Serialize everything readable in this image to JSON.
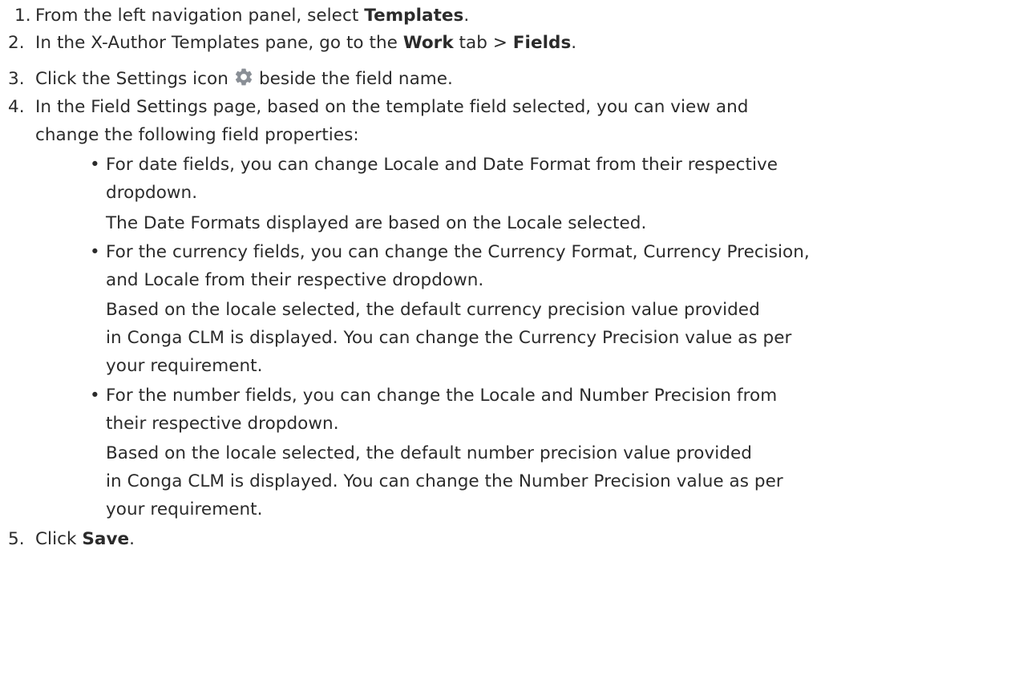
{
  "steps": [
    {
      "number": "1.",
      "pre": "From the left navigation panel, select ",
      "bold": "Templates",
      "post": "."
    },
    {
      "number": "2.",
      "pre": "In the X-Author Templates pane, go to the ",
      "bold1": "Work",
      "mid": " tab > ",
      "bold2": "Fields",
      "post": "."
    },
    {
      "number": "3.",
      "pre": "Click the Settings icon",
      "icon": "gear-icon",
      "post": "beside the field name."
    },
    {
      "number": "4.",
      "line1": "In the Field Settings page, based on the template field selected, you can view and",
      "line2": "change the following field properties:",
      "bullets": [
        {
          "lines": [
            "For date fields, you can change Locale and Date Format from their respective",
            "dropdown.",
            "The Date Formats displayed are based on the Locale selected."
          ]
        },
        {
          "lines": [
            "For the currency fields, you can change the Currency Format, Currency Precision,",
            "and Locale from their respective dropdown.",
            "Based on the locale selected, the default currency precision value provided",
            "in Conga CLM is displayed. You can change the Currency Precision value as per",
            "your requirement."
          ]
        },
        {
          "lines": [
            "For the number fields, you can change the Locale and Number Precision from",
            "their respective dropdown.",
            "Based on the locale selected, the default number precision value provided",
            "in Conga CLM is displayed. You can change the Number Precision value as per",
            "your requirement."
          ]
        }
      ],
      "bullet_symbol": "•"
    },
    {
      "number": "5.",
      "pre": "Click ",
      "bold": "Save",
      "post": "."
    }
  ],
  "colors": {
    "text": "#2b2b2b",
    "icon_gear": "#8a8f96"
  }
}
